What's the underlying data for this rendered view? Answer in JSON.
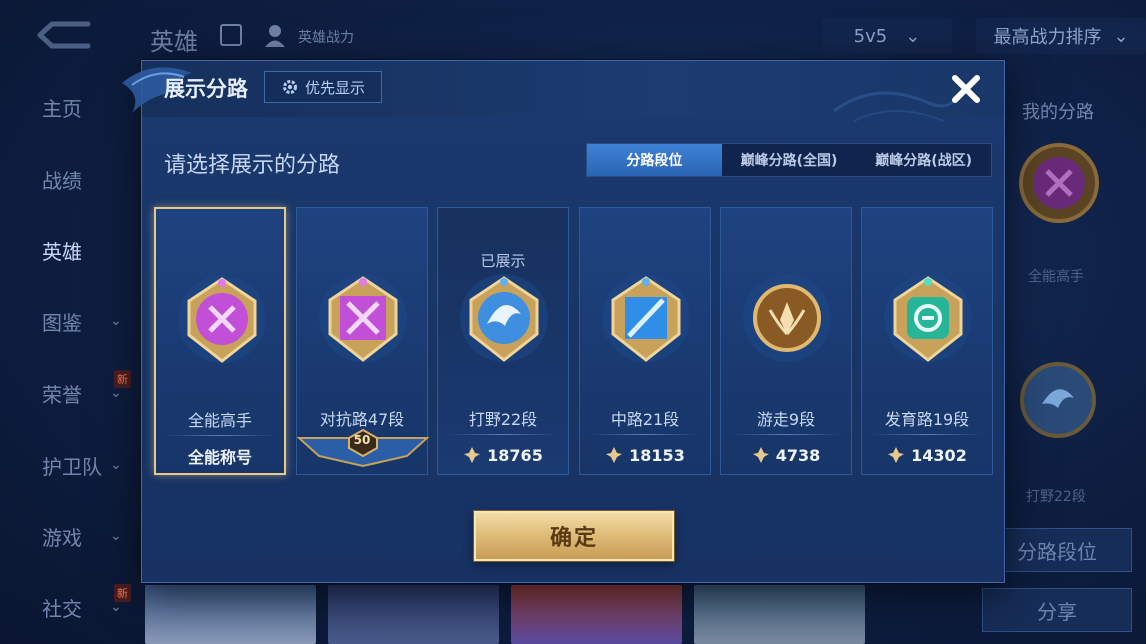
{
  "background": {
    "top_title": "英雄",
    "top_power_label": "英雄战力",
    "mode_select": "5v5",
    "sort_select": "最高战力排序",
    "sidebar": [
      {
        "label": "主页",
        "chevron": false,
        "new": false
      },
      {
        "label": "战绩",
        "chevron": false,
        "new": false
      },
      {
        "label": "英雄",
        "chevron": false,
        "new": false
      },
      {
        "label": "图鉴",
        "chevron": true,
        "new": false
      },
      {
        "label": "荣誉",
        "chevron": true,
        "new": true
      },
      {
        "label": "护卫队",
        "chevron": true,
        "new": false
      },
      {
        "label": "游戏",
        "chevron": true,
        "new": false
      },
      {
        "label": "社交",
        "chevron": true,
        "new": true
      }
    ],
    "new_badge": "新",
    "right_panel": {
      "my_lane_label": "我的分路",
      "top_badge_name": "全能高手",
      "bottom_badge_name": "打野22段",
      "lane_rank_button": "分路段位",
      "share_button": "分享"
    }
  },
  "modal": {
    "title": "展示分路",
    "priority_button": "优先显示",
    "subtitle": "请选择展示的分路",
    "tabs": [
      {
        "label": "分路段位",
        "active": true
      },
      {
        "label": "巅峰分路(全国)",
        "active": false
      },
      {
        "label": "巅峰分路(战区)",
        "active": false
      }
    ],
    "cards": [
      {
        "name": "全能高手",
        "footer": "全能称号",
        "footer_type": "text",
        "selected": true,
        "shown": "",
        "color": "#c24fd8"
      },
      {
        "name": "对抗路47段",
        "footer": "50",
        "footer_type": "level",
        "selected": false,
        "shown": "",
        "color": "#c24fd8"
      },
      {
        "name": "打野22段",
        "footer": "18765",
        "footer_type": "power",
        "selected": false,
        "shown": "已展示",
        "color": "#3f8fe0"
      },
      {
        "name": "中路21段",
        "footer": "18153",
        "footer_type": "power",
        "selected": false,
        "shown": "",
        "color": "#2f8fe8"
      },
      {
        "name": "游走9段",
        "footer": "4738",
        "footer_type": "power",
        "selected": false,
        "shown": "",
        "color": "#c58a3a"
      },
      {
        "name": "发育路19段",
        "footer": "14302",
        "footer_type": "power",
        "selected": false,
        "shown": "",
        "color": "#27b59a"
      }
    ],
    "confirm_button": "确定"
  },
  "colors": {
    "accent_blue": "#3f82d6",
    "gold": "#e0be7b",
    "selected_border": "#e7c98e"
  }
}
